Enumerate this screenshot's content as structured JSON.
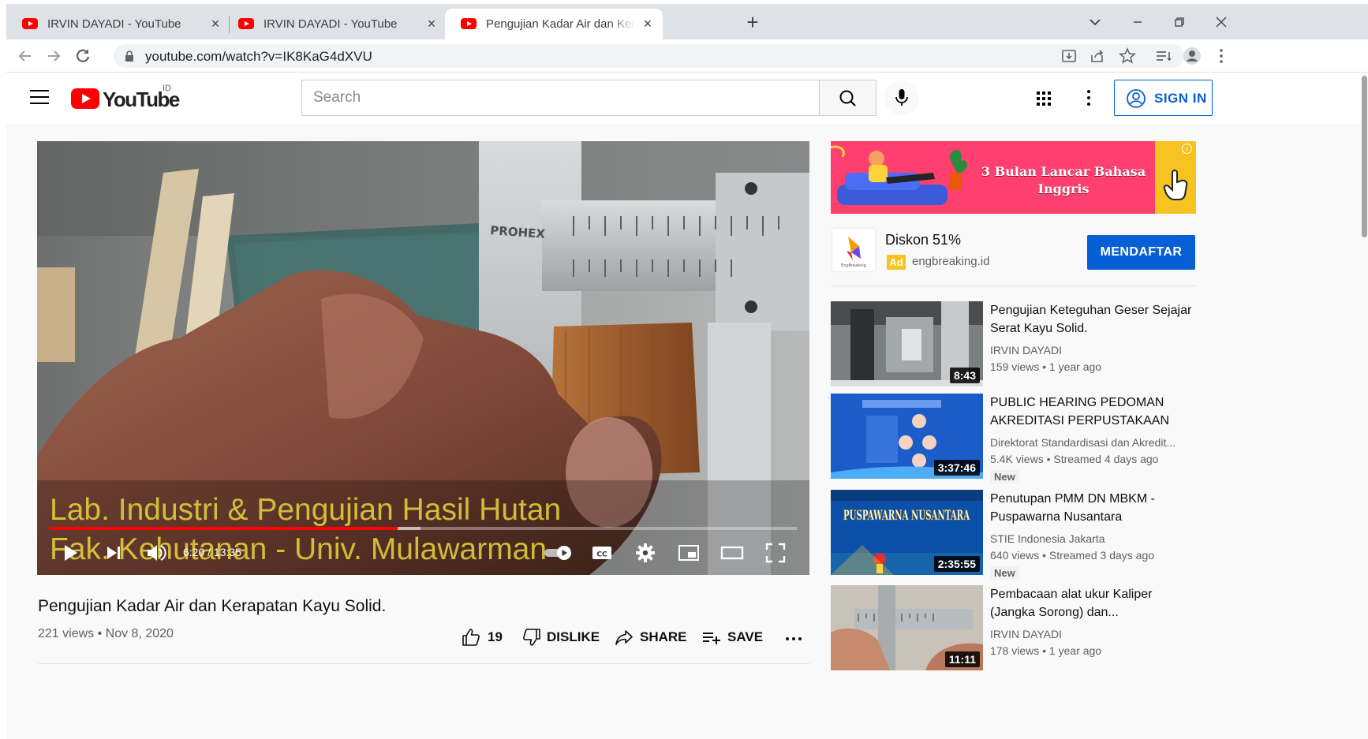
{
  "browser": {
    "tabs": [
      {
        "title": "IRVIN DAYADI - YouTube",
        "active": false
      },
      {
        "title": "IRVIN DAYADI - YouTube",
        "active": false
      },
      {
        "title": "Pengujian Kadar Air dan Kerapatan",
        "active": true
      }
    ],
    "url": "youtube.com/watch?v=IK8KaG4dXVU"
  },
  "youtube": {
    "logo_text": "YouTube",
    "country_code": "ID",
    "search_placeholder": "Search",
    "sign_in_label": "SIGN IN"
  },
  "player": {
    "caption_line1": "Lab. Industri & Pengujian Hasil Hutan",
    "caption_line2": "Fak. Kehutanan - Univ. Mulawarman",
    "time": "6:20 / 13:35",
    "progress_fraction": 0.466
  },
  "video": {
    "title": "Pengujian Kadar Air dan Kerapatan Kayu Solid.",
    "meta": "221 views • Nov 8, 2020",
    "likes": "19",
    "dislike_label": "DISLIKE",
    "share_label": "SHARE",
    "save_label": "SAVE"
  },
  "ad": {
    "banner_text": "3 Bulan Lancar Bahasa Inggris",
    "headline": "Diskon 51%",
    "badge": "Ad",
    "domain": "engbreaking.id",
    "cta": "MENDAFTAR",
    "logo_caption": "EngBreaking"
  },
  "recommendations": [
    {
      "title": "Pengujian Keteguhan Geser Sejajar Serat Kayu Solid.",
      "channel": "IRVIN DAYADI",
      "meta": "159 views • 1 year ago",
      "duration": "8:43",
      "badge": ""
    },
    {
      "title": "PUBLIC HEARING PEDOMAN AKREDITASI PERPUSTAKAAN",
      "channel": "Direktorat Standardisasi dan Akredit...",
      "meta": "5.4K views • Streamed 4 days ago",
      "duration": "3:37:46",
      "badge": "New"
    },
    {
      "title": "Penutupan PMM DN MBKM - Puspawarna Nusantara",
      "channel": "STIE Indonesia Jakarta",
      "meta": "640 views • Streamed 3 days ago",
      "duration": "2:35:55",
      "badge": "New",
      "thumb_text": "PUSPAWARNA NUSANTARA"
    },
    {
      "title": "Pembacaan alat ukur Kaliper (Jangka Sorong) dan...",
      "channel": "IRVIN DAYADI",
      "meta": "178 views • 1 year ago",
      "duration": "11:11",
      "badge": ""
    }
  ],
  "colors": {
    "youtube_red": "#ff0000",
    "link_blue": "#065fd4",
    "ad_pink": "#fe3f6f",
    "ad_yellow": "#f7c320",
    "caption_yellow": "#e8d63c"
  }
}
